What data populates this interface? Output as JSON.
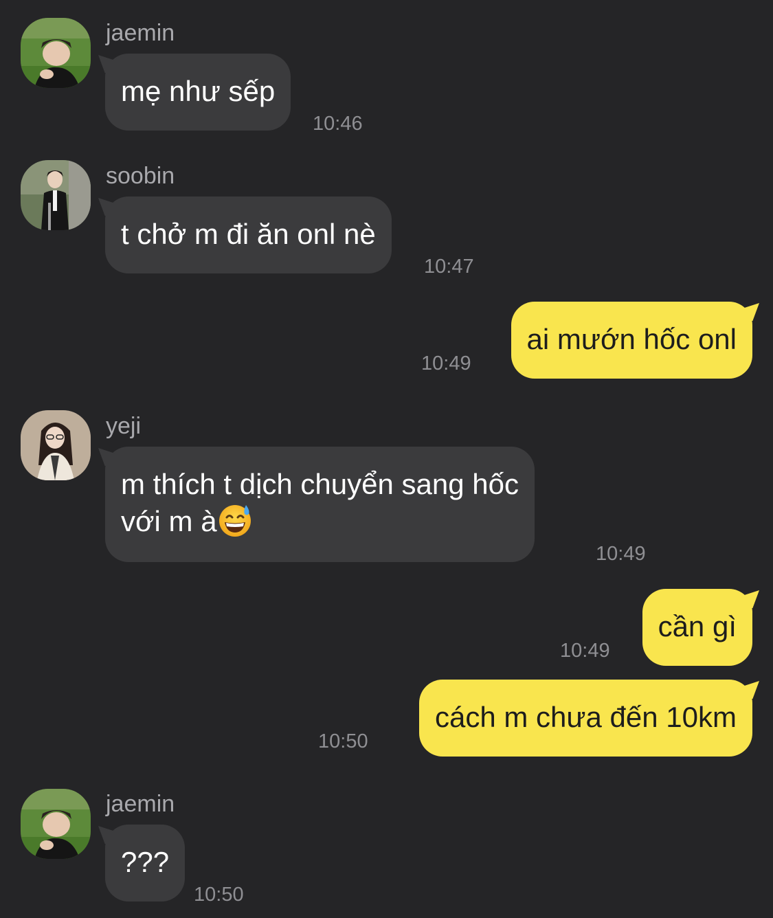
{
  "messages": [
    {
      "sender": "jaemin",
      "text": "mẹ như sếp",
      "time": "10:46",
      "avatar_icon": "avatar-photo-jaemin-icon"
    },
    {
      "sender": "soobin",
      "text": "t chở m đi ăn onl nè",
      "time": "10:47",
      "avatar_icon": "avatar-photo-soobin-icon"
    },
    {
      "sender": "me",
      "text": "ai mướn hốc onl",
      "time": "10:49"
    },
    {
      "sender": "yeji",
      "line1": "m thích t dịch chuyển sang hốc",
      "line2": "với m à",
      "emoji": "grinning-face-with-sweat-icon",
      "time": "10:49",
      "avatar_icon": "avatar-photo-yeji-icon"
    },
    {
      "sender": "me",
      "text": "cần gì",
      "time": "10:49"
    },
    {
      "sender": "me",
      "text": "cách m chưa đến 10km",
      "time": "10:50"
    },
    {
      "sender": "jaemin",
      "text": "???",
      "time": "10:50",
      "avatar_icon": "avatar-photo-jaemin-icon"
    }
  ],
  "colors": {
    "background": "#252527",
    "incoming_bubble": "#3b3b3d",
    "outgoing_bubble": "#f9e54e",
    "timestamp": "#8f8f93",
    "sender_name": "#a9a9ad"
  }
}
